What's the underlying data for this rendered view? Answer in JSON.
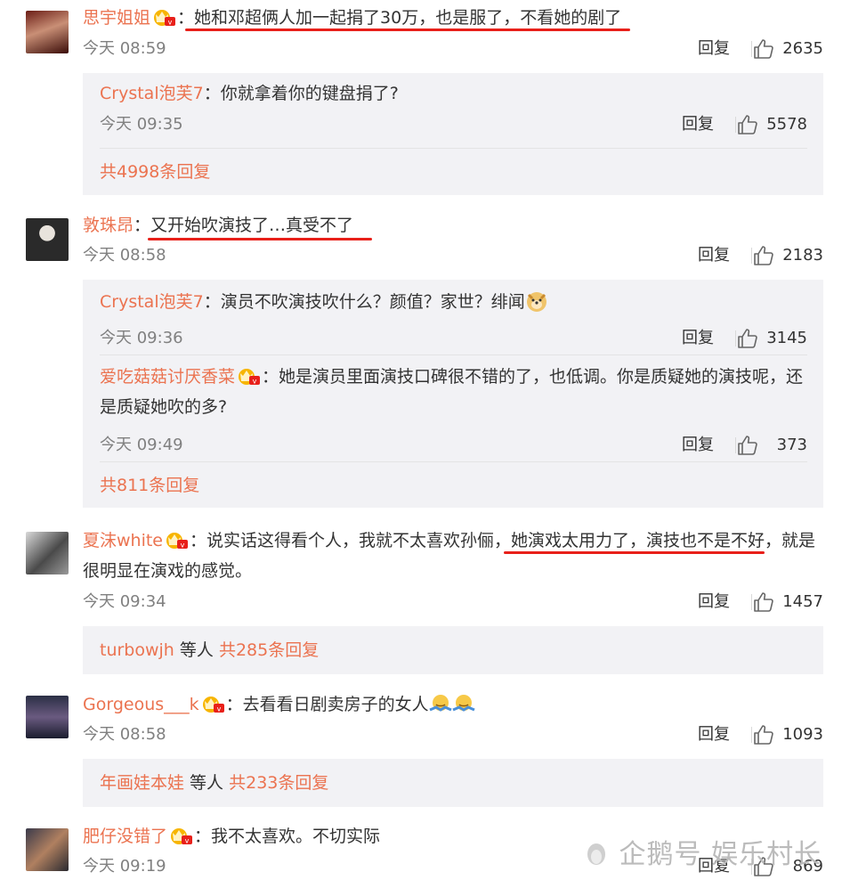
{
  "comments": [
    {
      "user": "思宇姐姐",
      "sep": "：",
      "text": "她和邓超俩人加一起捐了30万，也是服了，不看她的剧了",
      "time": "今天 08:59",
      "reply_label": "回复",
      "likes": "2635",
      "sub_replies": [
        {
          "user": "Crystal泡芙7",
          "sep": "：",
          "text": "你就拿着你的键盘捐了?",
          "time": "今天 09:35",
          "reply_label": "回复",
          "likes": "5578"
        }
      ],
      "more_text": "共4998条回复"
    },
    {
      "user": "敦珠昂",
      "sep": "：",
      "text": "又开始吹演技了…真受不了",
      "time": "今天 08:58",
      "reply_label": "回复",
      "likes": "2183",
      "sub_replies": [
        {
          "user": "Crystal泡芙7",
          "sep": "：",
          "text": "演员不吹演技吹什么？颜值？家世？绯闻",
          "time": "今天 09:36",
          "reply_label": "回复",
          "likes": "3145"
        },
        {
          "user": "爱吃菇菇讨厌香菜",
          "sep": "：",
          "text": "她是演员里面演技口碑很不错的了，也低调。你是质疑她的演技呢，还是质疑她吹的多?",
          "time": "今天 09:49",
          "reply_label": "回复",
          "likes": "373"
        }
      ],
      "more_text": "共811条回复"
    },
    {
      "user": "夏沫white",
      "sep": "：",
      "text": "说实话这得看个人，我就不太喜欢孙俪，她演戏太用力了，演技也不是不好，就是很明显在演戏的感觉。",
      "time": "今天 09:34",
      "reply_label": "回复",
      "likes": "1457",
      "more_user": "turbowjh",
      "more_mid": " 等人 ",
      "more_text": "共285条回复"
    },
    {
      "user": "Gorgeous___k",
      "sep": "：",
      "text": "去看看日剧卖房子的女人",
      "time": "今天 08:58",
      "reply_label": "回复",
      "likes": "1093",
      "more_user": "年画娃本娃",
      "more_mid": " 等人 ",
      "more_text": "共233条回复"
    },
    {
      "user": "肥仔没错了",
      "sep": "：",
      "text": "我不太喜欢。不切实际",
      "time": "今天 09:19",
      "reply_label": "回复",
      "likes": "869"
    }
  ],
  "watermark": "企鹅号 娱乐村长",
  "colors": {
    "name": "#eb7350",
    "underline": "#e8201a",
    "reply_bg": "#f2f2f5"
  },
  "icons": {
    "like": "thumbs-up-icon",
    "badge": "vip-crown-badge-icon",
    "emoji_doge": "doge-emoji-icon",
    "emoji_shrug": "shrug-emoji-icon"
  }
}
